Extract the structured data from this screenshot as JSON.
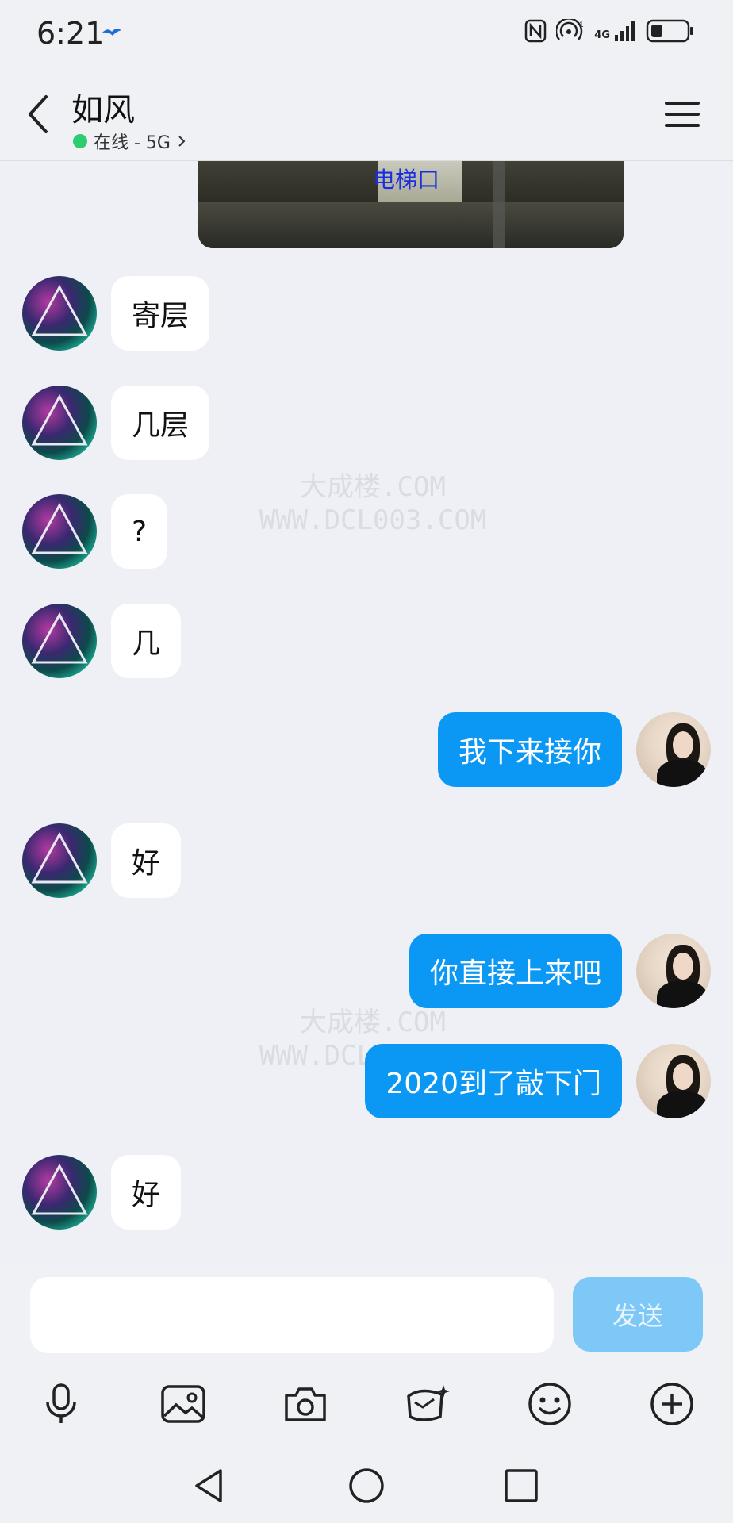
{
  "status_bar": {
    "time": "6:21",
    "signal_label": "4G",
    "sim_index": "1"
  },
  "header": {
    "title": "如风",
    "presence": "在线 - 5G"
  },
  "image_message": {
    "label": "电梯口"
  },
  "messages": [
    {
      "side": "in",
      "text": "寄层"
    },
    {
      "side": "in",
      "text": "几层"
    },
    {
      "side": "in",
      "text": "?"
    },
    {
      "side": "in",
      "text": "几"
    },
    {
      "side": "out",
      "text": "我下来接你"
    },
    {
      "side": "in",
      "text": "好"
    },
    {
      "side": "out",
      "text": "你直接上来吧"
    },
    {
      "side": "out",
      "text": "2020到了敲下门"
    },
    {
      "side": "in",
      "text": "好"
    }
  ],
  "watermark": {
    "line1": "大成楼.COM",
    "line2": "WWW.DCL003.COM"
  },
  "input": {
    "placeholder": "",
    "send_label": "发送"
  },
  "toolbar": [
    "mic-icon",
    "image-icon",
    "camera-icon",
    "red-envelope-icon",
    "emoji-icon",
    "add-icon"
  ],
  "colors": {
    "accent": "#0b98f5",
    "send_disabled": "#7ec8f8",
    "online": "#2ecc71",
    "background": "#eef0f5"
  }
}
